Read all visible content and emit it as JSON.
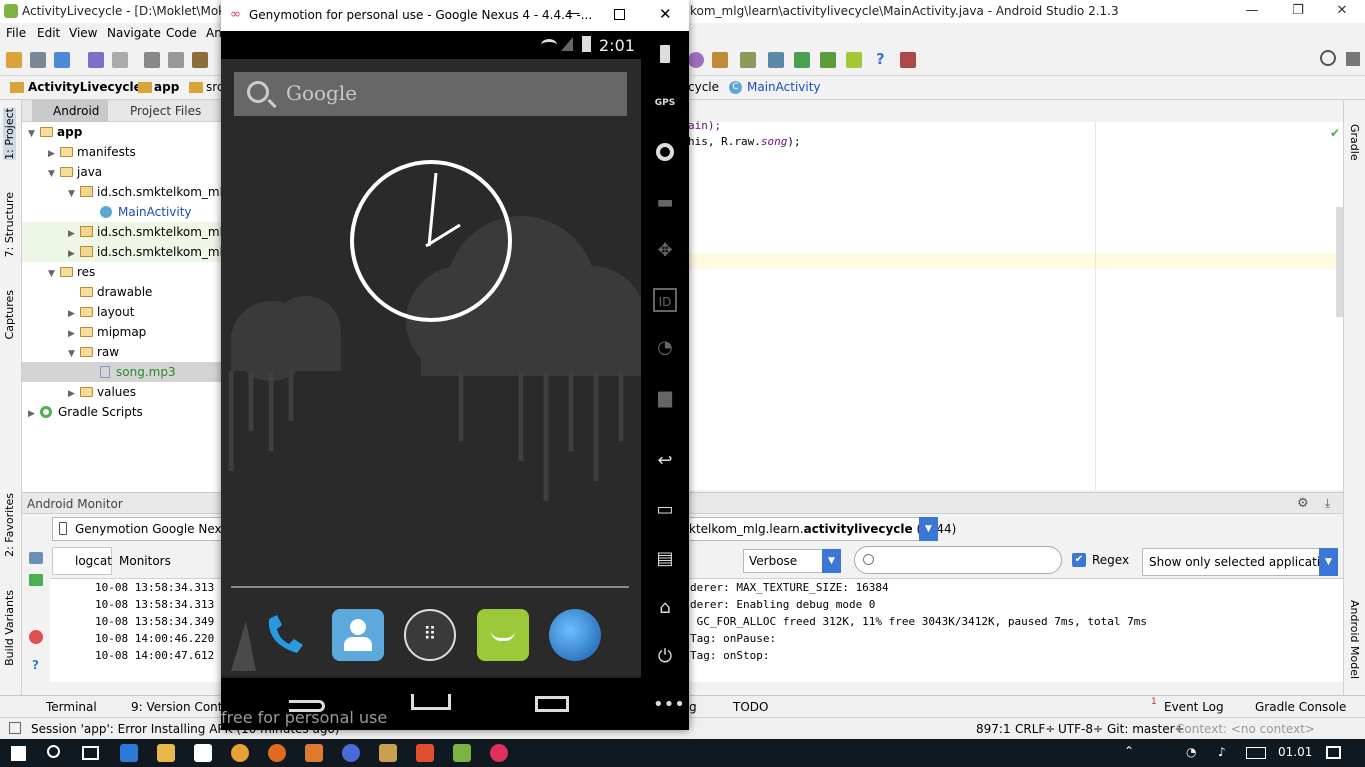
{
  "window": {
    "title": "ActivityLivecycle - [D:\\Moklet\\Moklet",
    "title_right": "kom_mlg\\learn\\activitylivecycle\\MainActivity.java - Android Studio 2.1.3"
  },
  "menu": [
    "File",
    "Edit",
    "View",
    "Navigate",
    "Code",
    "An"
  ],
  "breadcrumb": {
    "project": "ActivityLivecycle",
    "app": "app",
    "src": "src",
    "right_partial": "cycle",
    "file": "MainActivity"
  },
  "project_panel": {
    "tab_android": "Android",
    "tab_files": "Project Files"
  },
  "tree": [
    {
      "label": "app",
      "indent": 0,
      "arrow": "▼",
      "type": "module",
      "bold": true
    },
    {
      "label": "manifests",
      "indent": 1,
      "arrow": "▶",
      "type": "folder"
    },
    {
      "label": "java",
      "indent": 1,
      "arrow": "▼",
      "type": "folder"
    },
    {
      "label": "id.sch.smktelkom_mlg",
      "indent": 2,
      "arrow": "▼",
      "type": "package"
    },
    {
      "label": "MainActivity",
      "indent": 3,
      "arrow": "",
      "type": "class",
      "color": "#1a4dc2"
    },
    {
      "label": "id.sch.smktelkom_mlg",
      "indent": 2,
      "arrow": "▶",
      "type": "package",
      "highlight": true
    },
    {
      "label": "id.sch.smktelkom_mlg",
      "indent": 2,
      "arrow": "▶",
      "type": "package",
      "highlight": true
    },
    {
      "label": "res",
      "indent": 1,
      "arrow": "▼",
      "type": "folder"
    },
    {
      "label": "drawable",
      "indent": 2,
      "arrow": "",
      "type": "folder"
    },
    {
      "label": "layout",
      "indent": 2,
      "arrow": "▶",
      "type": "folder"
    },
    {
      "label": "mipmap",
      "indent": 2,
      "arrow": "▶",
      "type": "folder"
    },
    {
      "label": "raw",
      "indent": 2,
      "arrow": "▼",
      "type": "folder"
    },
    {
      "label": "song.mp3",
      "indent": 3,
      "arrow": "",
      "type": "file",
      "color": "#2a8a2a",
      "selected": true
    },
    {
      "label": "values",
      "indent": 2,
      "arrow": "▶",
      "type": "folder"
    },
    {
      "label": "Gradle Scripts",
      "indent": 0,
      "arrow": "▶",
      "type": "gradle"
    }
  ],
  "editor": {
    "line1": "ain);",
    "line2a": "his, R.raw.",
    "line2b": "song",
    "line2c": ");"
  },
  "left_tools": {
    "project": "1: Project",
    "structure": "7: Structure",
    "captures": "Captures",
    "favorites": "2: Favorites",
    "build": "Build Variants"
  },
  "right_tools": {
    "gradle": "Gradle",
    "android_model": "Android Model"
  },
  "monitor": {
    "title": "Android Monitor",
    "device": "Genymotion Google Nexus",
    "process_prefix": "ktelkom_mlg.learn.",
    "process_bold": "activitylivecycle",
    "process_suffix": " (1444)",
    "tab_logcat": "logcat",
    "tab_monitors": "Monitors",
    "level": "Verbose",
    "search_placeholder": "",
    "regex_label": "Regex",
    "filter": "Show only selected application"
  },
  "log_left": [
    "10-08 13:58:34.313",
    "10-08 13:58:34.313",
    "10-08 13:58:34.349",
    "10-08 14:00:46.220",
    "10-08 14:00:47.612"
  ],
  "log_right": [
    "derer: MAX_TEXTURE_SIZE: 16384",
    "derer: Enabling debug mode 0",
    " GC_FOR_ALLOC freed 312K, 11% free 3043K/3412K, paused 7ms, total 7ms",
    "Tag: onPause:",
    "Tag: onStop:"
  ],
  "bottom_tools": {
    "terminal": "Terminal",
    "version_control": "9: Version Contro",
    "g": "g",
    "todo": "TODO",
    "event_log": "Event Log",
    "event_count": "1",
    "gradle_console": "Gradle Console"
  },
  "status": {
    "message": "Session 'app': Error Installing APK (10 minutes ago)",
    "position": "897:1",
    "crlf": "CRLF÷",
    "encoding": "UTF-8÷",
    "git": "Git: master÷",
    "context": "Context: <no context>"
  },
  "genymotion": {
    "title": "Genymotion for personal use - Google Nexus 4 - 4.4.4 -...",
    "time": "2:01",
    "search": "Google",
    "watermark": "free for personal use",
    "gps": "GPS",
    "id": "ID"
  },
  "taskbar": {
    "clock": "01.01"
  },
  "colors": {
    "accent": "#3d77d6",
    "android_green": "#a4c639",
    "selection": "#d4d4d4"
  }
}
